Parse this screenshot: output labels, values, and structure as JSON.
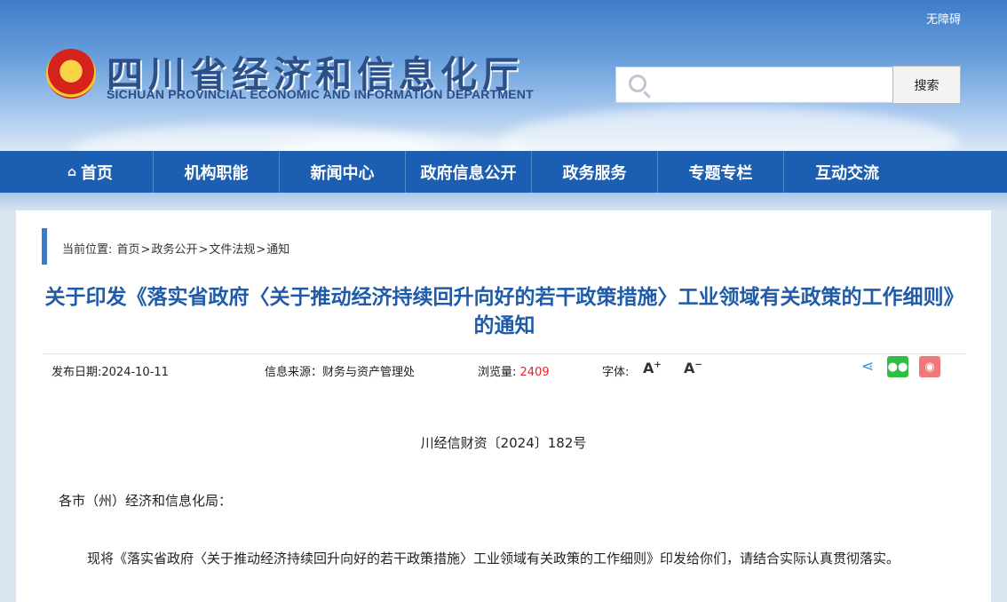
{
  "header": {
    "accessibility_link": "无障碍",
    "site_title_cn": "四川省经济和信息化厅",
    "site_title_en": "SICHUAN PROVINCIAL ECONOMIC AND INFORMATION DEPARTMENT",
    "search": {
      "placeholder": "",
      "button_label": "搜索"
    }
  },
  "nav": {
    "items": [
      {
        "label": "首页"
      },
      {
        "label": "机构职能"
      },
      {
        "label": "新闻中心"
      },
      {
        "label": "政府信息公开"
      },
      {
        "label": "政务服务"
      },
      {
        "label": "专题专栏"
      },
      {
        "label": "互动交流"
      }
    ]
  },
  "breadcrumb": {
    "prefix": "当前位置:",
    "items": [
      "首页",
      "政务公开",
      "文件法规",
      "通知"
    ],
    "separator": ">"
  },
  "article": {
    "title": "关于印发《落实省政府〈关于推动经济持续回升向好的若干政策措施〉工业领域有关政策的工作细则》的通知",
    "meta": {
      "publish_label": "发布日期:",
      "publish_date": "2024-10-11",
      "source_label": "信息来源：",
      "source": "财务与资产管理处",
      "views_label": "浏览量:",
      "views": "2409",
      "font_label": "字体:",
      "font_up": "A",
      "font_down": "A"
    },
    "doc_number": "川经信财资〔2024〕182号",
    "addressee": "各市（州）经济和信息化局：",
    "paragraph": "现将《落实省政府〈关于推动经济持续回升向好的若干政策措施〉工业领域有关政策的工作细则》印发给你们，请结合实际认真贯彻落实。"
  },
  "colors": {
    "nav_bg": "#1c5fb2",
    "title_blue": "#1f5ba8",
    "views_red": "#e0242a",
    "wechat_green": "#2fbd43",
    "weibo_pink": "#f0787a"
  }
}
